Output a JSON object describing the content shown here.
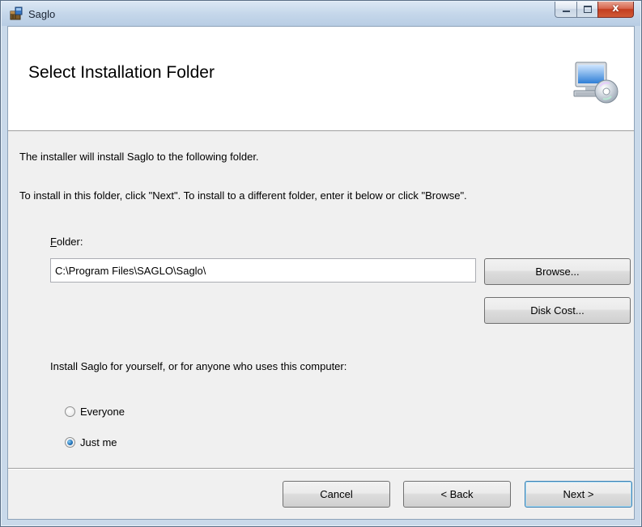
{
  "window": {
    "title": "Saglo",
    "icons": {
      "app": "installer-box-icon",
      "minimize": "minimize-icon",
      "maximize": "maximize-icon",
      "close": "close-icon"
    },
    "close_glyph": "x"
  },
  "banner": {
    "title": "Select Installation Folder",
    "icon": "computer-with-disc-icon"
  },
  "body": {
    "line1": "The installer will install Saglo to the following folder.",
    "line2": "To install in this folder, click \"Next\". To install to a different folder, enter it below or click \"Browse\".",
    "folder_label_accel": "F",
    "folder_label_rest": "older:",
    "folder_value": "C:\\Program Files\\SAGLO\\Saglo\\",
    "browse_label": "Browse...",
    "disk_cost_label": "Disk Cost...",
    "install_for_label": "Install Saglo for yourself, or for anyone who uses this computer:",
    "options": [
      {
        "label": "Everyone",
        "checked": false
      },
      {
        "label": "Just me",
        "checked": true
      }
    ]
  },
  "footer": {
    "cancel_label": "Cancel",
    "back_label": "< Back",
    "next_label": "Next >"
  },
  "colors": {
    "title_bar": "#c5d7ea",
    "client_bg": "#f0f0f0",
    "close_button": "#c33d20",
    "default_button_border": "#3c7fb1"
  }
}
